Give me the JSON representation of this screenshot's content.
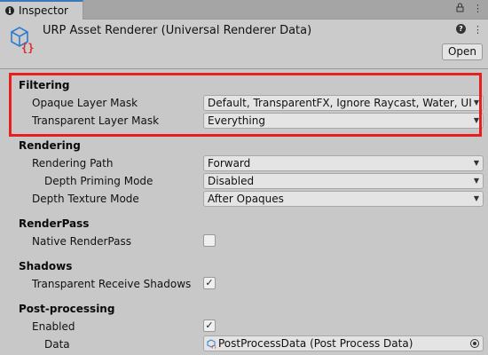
{
  "tab": {
    "label": "Inspector",
    "info_icon": "i",
    "lock_icon": "🔒",
    "menu_icon": "⋮"
  },
  "header": {
    "title": "URP Asset Renderer (Universal Renderer Data)",
    "help_icon": "?",
    "menu_icon": "⋮",
    "open_label": "Open"
  },
  "sections": {
    "filtering": {
      "title": "Filtering",
      "opaque_label": "Opaque Layer Mask",
      "opaque_value": "Default, TransparentFX, Ignore Raycast, Water, UI",
      "transparent_label": "Transparent Layer Mask",
      "transparent_value": "Everything"
    },
    "rendering": {
      "title": "Rendering",
      "path_label": "Rendering Path",
      "path_value": "Forward",
      "depth_priming_label": "Depth Priming Mode",
      "depth_priming_value": "Disabled",
      "depth_texture_label": "Depth Texture Mode",
      "depth_texture_value": "After Opaques"
    },
    "renderpass": {
      "title": "RenderPass",
      "native_label": "Native RenderPass",
      "native_checked": false
    },
    "shadows": {
      "title": "Shadows",
      "transparent_receive_label": "Transparent Receive Shadows",
      "transparent_receive_checked": true
    },
    "postprocessing": {
      "title": "Post-processing",
      "enabled_label": "Enabled",
      "enabled_checked": true,
      "data_label": "Data",
      "data_value": "PostProcessData (Post Process Data)"
    }
  },
  "check_glyph": "✓",
  "dropdown_glyph": "▼",
  "highlight_color": "#e81f1f"
}
